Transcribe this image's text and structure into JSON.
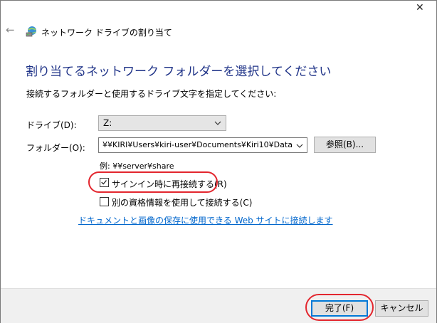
{
  "window": {
    "title": "ネットワーク ドライブの割り当て",
    "close_glyph": "✕",
    "back_glyph": "←"
  },
  "heading": "割り当てるネットワーク フォルダーを選択してください",
  "instruction": "接続するフォルダーと使用するドライブ文字を指定してください:",
  "drive": {
    "label": "ドライブ(D):",
    "value": "Z:"
  },
  "folder": {
    "label": "フォルダー(O):",
    "value": "¥¥KIRI¥Users¥kiri-user¥Documents¥Kiri10¥Data",
    "browse_label": "参照(B)...",
    "example": "例: ¥¥server¥share"
  },
  "options": {
    "reconnect": {
      "label": "サインイン時に再接続する(R)",
      "checked": true
    },
    "other_credentials": {
      "label": "別の資格情報を使用して接続する(C)",
      "checked": false
    }
  },
  "link": "ドキュメントと画像の保存に使用できる Web サイトに接続します",
  "buttons": {
    "finish": "完了(F)",
    "cancel": "キャンセル"
  },
  "colors": {
    "heading": "#1e3287",
    "link": "#0066cc",
    "highlight": "#e3262e",
    "primary_border": "#0078d7"
  },
  "icons": {
    "back": "back-arrow-icon",
    "network": "network-drive-icon",
    "close": "close-icon",
    "chevron": "chevron-down-icon",
    "checkmark": "checkmark-icon"
  }
}
